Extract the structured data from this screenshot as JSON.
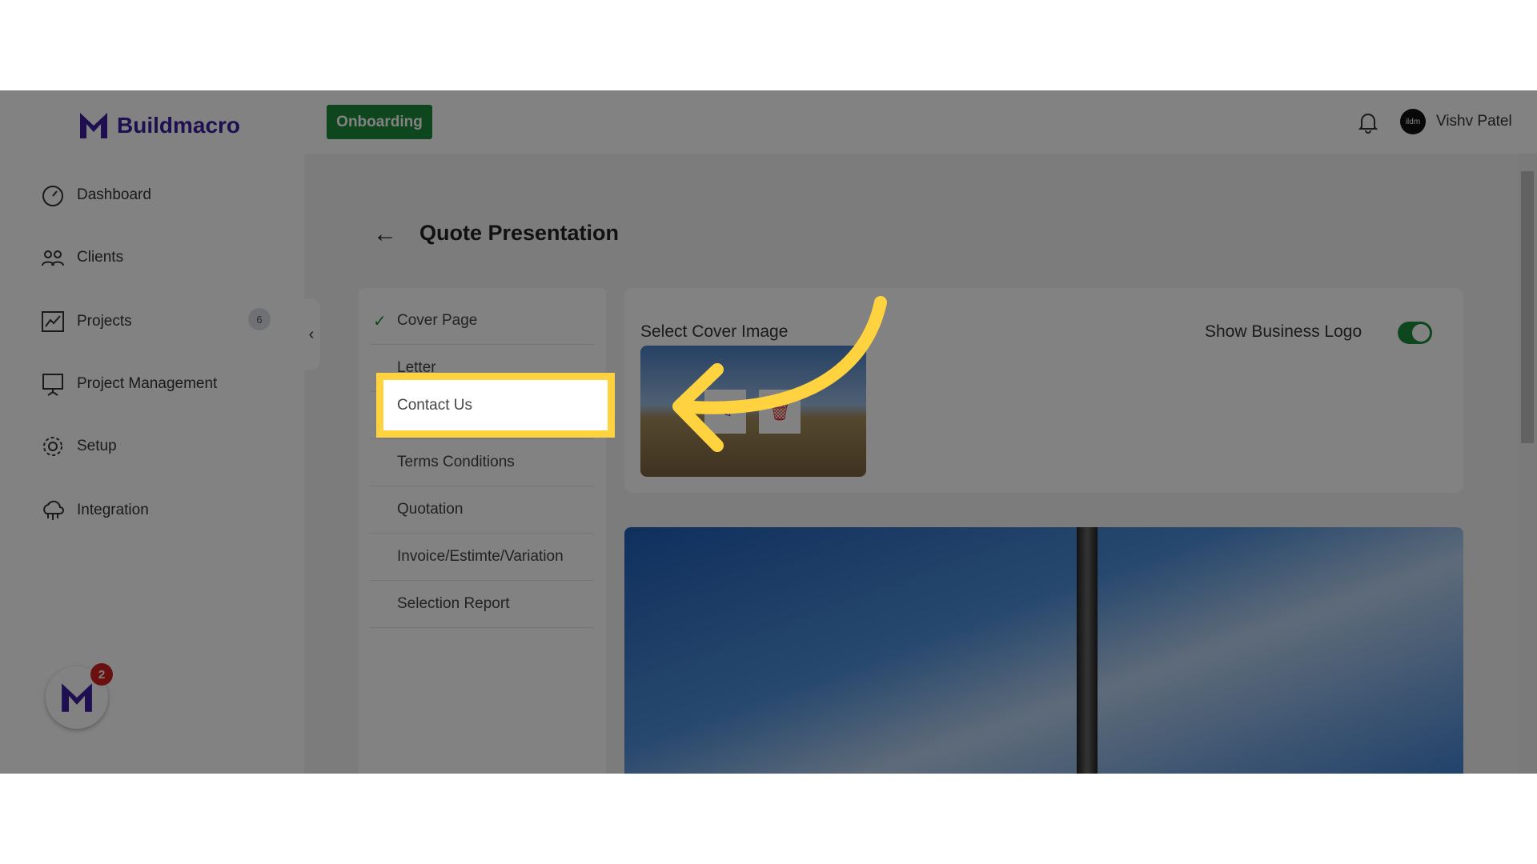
{
  "brand": {
    "name": "Buildmacro",
    "accent": "#3b1f9e"
  },
  "header": {
    "onboarding_label": "Onboarding",
    "user_name": "Vishv Patel",
    "avatar_text": "ildm"
  },
  "sidebar": {
    "items": [
      {
        "label": "Dashboard",
        "icon": "gauge-icon"
      },
      {
        "label": "Clients",
        "icon": "users-icon"
      },
      {
        "label": "Projects",
        "icon": "chart-icon",
        "badge": "6"
      },
      {
        "label": "Project Management",
        "icon": "presentation-icon"
      },
      {
        "label": "Setup",
        "icon": "gear-icon"
      },
      {
        "label": "Integration",
        "icon": "cloud-network-icon"
      }
    ]
  },
  "page": {
    "title": "Quote Presentation"
  },
  "steps": [
    {
      "label": "Cover Page",
      "done": true
    },
    {
      "label": "Letter"
    },
    {
      "label": "Contact Us",
      "highlighted": true
    },
    {
      "label": "Terms Conditions"
    },
    {
      "label": "Quotation"
    },
    {
      "label": "Invoice/Estimte/Variation"
    },
    {
      "label": "Selection Report"
    }
  ],
  "cover": {
    "select_label": "Select Cover Image",
    "logo_label": "Show Business Logo",
    "show_logo": true
  },
  "chat": {
    "badge": "2"
  },
  "colors": {
    "green": "#1d8a3c",
    "highlight": "#ffd23f"
  }
}
